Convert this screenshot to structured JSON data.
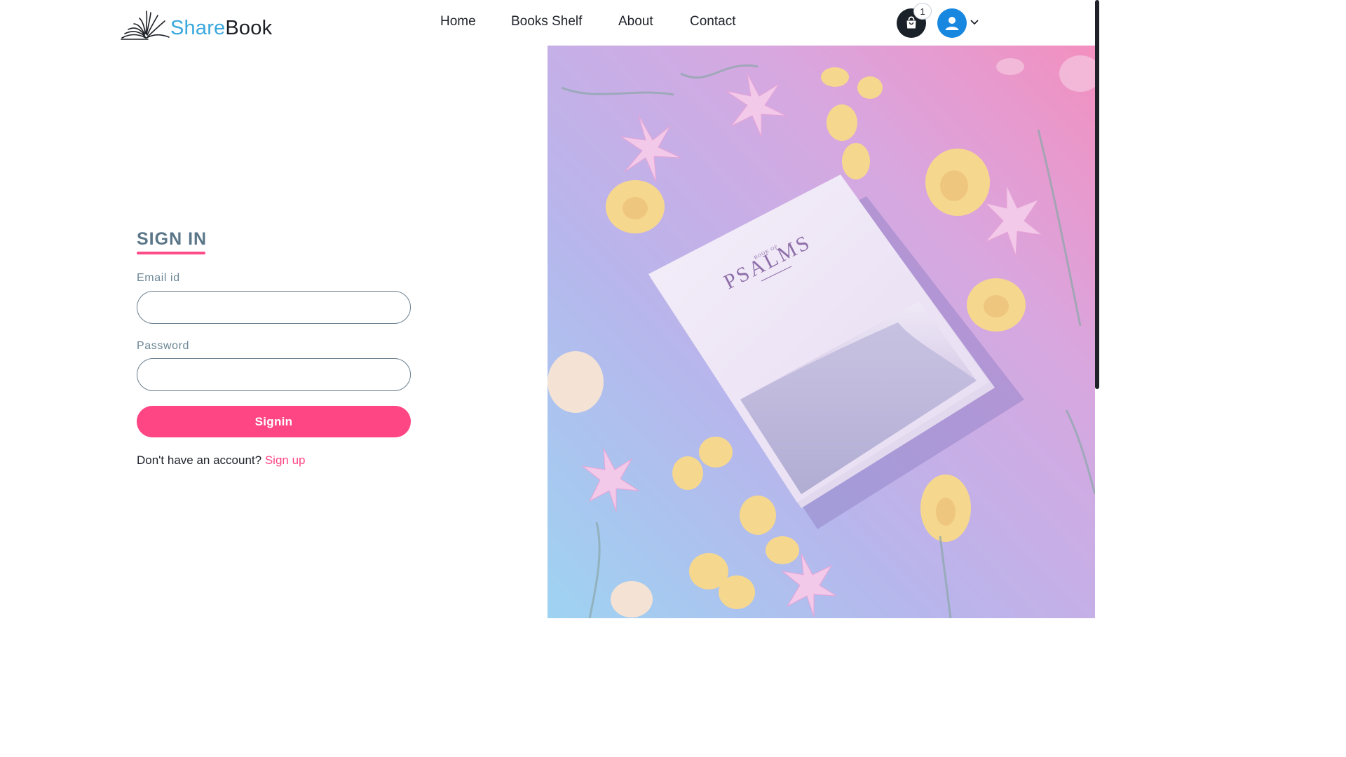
{
  "header": {
    "logo": {
      "share_text": "Share",
      "book_text": "Book",
      "icon": "open-book-icon"
    },
    "nav": [
      {
        "id": "home",
        "label": "Home"
      },
      {
        "id": "books-shelf",
        "label": "Books Shelf"
      },
      {
        "id": "about",
        "label": "About"
      },
      {
        "id": "contact",
        "label": "Contact"
      }
    ],
    "cart": {
      "icon": "shopping-bag-icon",
      "count": "1"
    },
    "account": {
      "icon": "user-icon",
      "caret_icon": "chevron-down-icon"
    }
  },
  "signin": {
    "title": "SIGN IN",
    "email_label": "Email id",
    "email_value": "",
    "password_label": "Password",
    "password_value": "",
    "button_label": "Signin",
    "signup_prompt": "Don't have an account?",
    "signup_link": "Sign up"
  },
  "hero": {
    "book_title": "PSALMS",
    "book_subtitle": "BOOK OF"
  },
  "colors": {
    "accent": "#ff4685",
    "heading": "#5a7688",
    "logo_blue": "#3aa8dd",
    "avatar_blue": "#1787e0",
    "cart_dark": "#1b2129"
  }
}
